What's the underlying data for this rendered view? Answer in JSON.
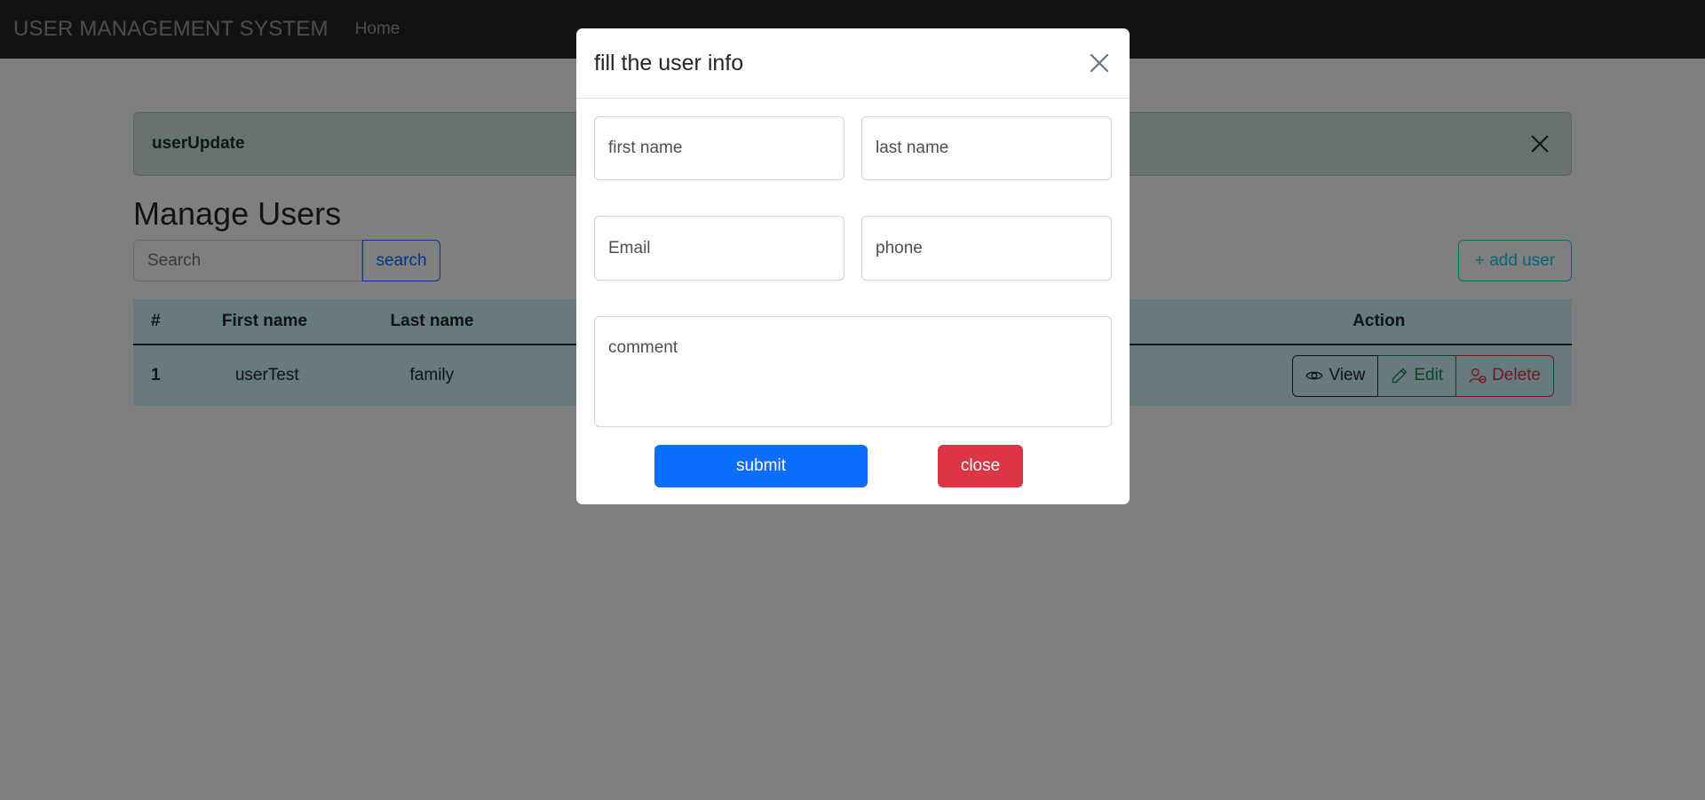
{
  "navbar": {
    "brand": "USER MANAGEMENT SYSTEM",
    "home": "Home"
  },
  "alert": {
    "message": "userUpdate"
  },
  "page": {
    "title": "Manage Users"
  },
  "search": {
    "placeholder": "Search",
    "button": "search"
  },
  "add_user": "+ add user",
  "table": {
    "headers": {
      "index": "#",
      "first_name": "First name",
      "last_name": "Last name",
      "action": "Action"
    },
    "rows": [
      {
        "index": "1",
        "first_name": "userTest",
        "last_name": "family"
      }
    ],
    "actions": {
      "view": "View",
      "edit": "Edit",
      "delete": "Delete"
    }
  },
  "modal": {
    "title": "fill the user info",
    "fields": {
      "first_name": "first name",
      "last_name": "last name",
      "email": "Email",
      "phone": "phone",
      "comment": "comment"
    },
    "submit": "submit",
    "close": "close"
  },
  "colors": {
    "primary": "#0d6efd",
    "danger": "#dc3545",
    "info": "#0dcaf0",
    "navbar": "#212529"
  }
}
